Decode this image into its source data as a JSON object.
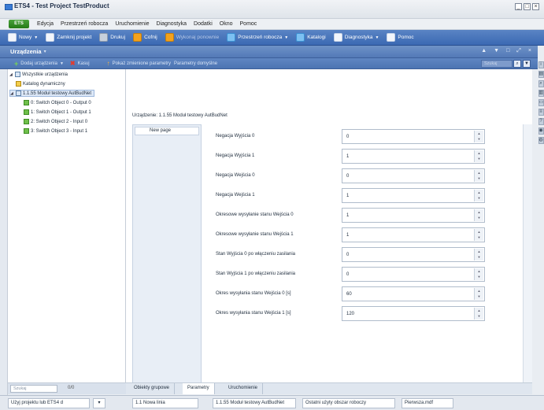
{
  "window": {
    "title": "ETS4 - Test Project TestProduct",
    "controls": [
      "_",
      "□",
      "×"
    ]
  },
  "menubar": {
    "app_button": "ETS",
    "items": [
      "Edycja",
      "Przestrzeń robocza",
      "Uruchomienie",
      "Diagnostyka",
      "Dodatki",
      "Okno",
      "Pomoc"
    ]
  },
  "toolbar": {
    "new": "Nowy",
    "close_project": "Zamknij projekt",
    "print": "Drukuj",
    "undo": "Cofnij",
    "redo": "Wykonaj ponownie",
    "workspace": "Przestrzeń robocza",
    "catalogs": "Katalogi",
    "diagnostics": "Diagnostyka",
    "help": "Pomoc"
  },
  "panel": {
    "title": "Urządzenia",
    "controls": [
      "▾",
      "▲",
      "▼",
      "□",
      "⤢",
      "×"
    ]
  },
  "subbar": {
    "add_devices": "Dodaj urządzenia",
    "delete": "Kasuj",
    "show_changed": "Pokaż zmienione parametry",
    "default_params": "Parametry domyślne",
    "search_placeholder": "Szukaj"
  },
  "tree": {
    "items": [
      {
        "label": "Wszystkie urządzenia"
      },
      {
        "label": "Katalog dynamiczny"
      },
      {
        "label": "1.1.55 Moduł testowy AutBudNet"
      },
      {
        "label": "0: Switch Object 0 - Output 0"
      },
      {
        "label": "1: Switch Object 1 - Output 1"
      },
      {
        "label": "2: Switch Object 2 - Input 0"
      },
      {
        "label": "3: Switch Object 3 - Input 1"
      }
    ],
    "search_placeholder": "Szukaj",
    "count": "0/0"
  },
  "main": {
    "breadcrumb": "Urządzenie: 1.1.55 Moduł testowy AutBudNet",
    "pages": [
      "New page"
    ],
    "parameters": [
      {
        "label": "Negacja Wyjścia 0",
        "value": "0"
      },
      {
        "label": "Negacja Wyjścia 1",
        "value": "1"
      },
      {
        "label": "Negacja Wejścia 0",
        "value": "0"
      },
      {
        "label": "Negacja Wejścia 1",
        "value": "1"
      },
      {
        "label": "Okresowe wysyłanie stanu Wejścia 0",
        "value": "1"
      },
      {
        "label": "Okresowe wysyłanie stanu Wejścia 1",
        "value": "1"
      },
      {
        "label": "Stan Wyjścia 0 po włączeniu zasilania",
        "value": "0"
      },
      {
        "label": "Stan Wyjścia 1 po włączeniu zasilania",
        "value": "0"
      },
      {
        "label": "Okres wysyłania stanu Wejścia 0 [s]",
        "value": "60"
      },
      {
        "label": "Okres wysyłania stanu Wejścia 1 [s]",
        "value": "120"
      }
    ]
  },
  "bottom_tabs": [
    "Obiekty grupowe",
    "Parametry",
    "Uruchomienie"
  ],
  "statusbar": {
    "use_project": "Użyj projektu lub ETS4 d",
    "line": "1.1 Nowa linia",
    "device": "1.1.55 Moduł testowy AutBudNet",
    "last_workspace": "Ostatni użyty obszar roboczy",
    "file": "Pierwsza.mdf"
  },
  "colors": {
    "toolbar": "#4a77bc",
    "panel_header": "#6289c2",
    "accent_green": "#3a9a2d"
  }
}
